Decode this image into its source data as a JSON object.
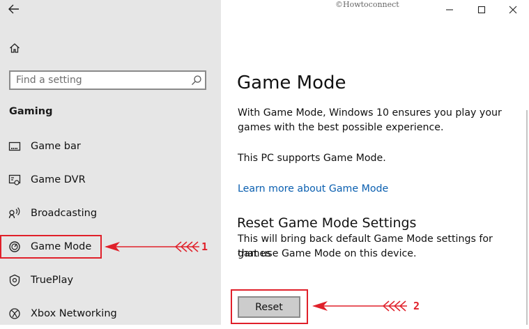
{
  "sidebar": {
    "search": {
      "placeholder": "Find a setting",
      "value": ""
    },
    "section_title": "Gaming",
    "items": [
      {
        "label": "Game bar",
        "icon": "game-bar-icon"
      },
      {
        "label": "Game DVR",
        "icon": "game-dvr-icon"
      },
      {
        "label": "Broadcasting",
        "icon": "broadcasting-icon"
      },
      {
        "label": "Game Mode",
        "icon": "game-mode-icon",
        "selected": true
      },
      {
        "label": "TruePlay",
        "icon": "trueplay-icon"
      },
      {
        "label": "Xbox Networking",
        "icon": "xbox-networking-icon"
      }
    ]
  },
  "titlebar": {
    "watermark": "©Howtoconnect"
  },
  "main": {
    "title": "Game Mode",
    "description_line1": "With Game Mode, Windows 10 ensures you play your",
    "description_line2": "games with the best possible experience.",
    "support_text": "This PC supports Game Mode.",
    "learn_more_link": "Learn more about Game Mode",
    "reset_section_title": "Reset Game Mode Settings",
    "reset_desc_line1": "This will bring back default Game Mode settings for games",
    "reset_desc_line2": "that use Game Mode on this device.",
    "reset_button": "Reset"
  },
  "annotations": {
    "marker1": "1",
    "marker2": "2",
    "color": "#e0202a"
  },
  "colors": {
    "sidebar_bg": "#e6e6e6",
    "link": "#0a5fb0",
    "annotation": "#e0202a"
  }
}
